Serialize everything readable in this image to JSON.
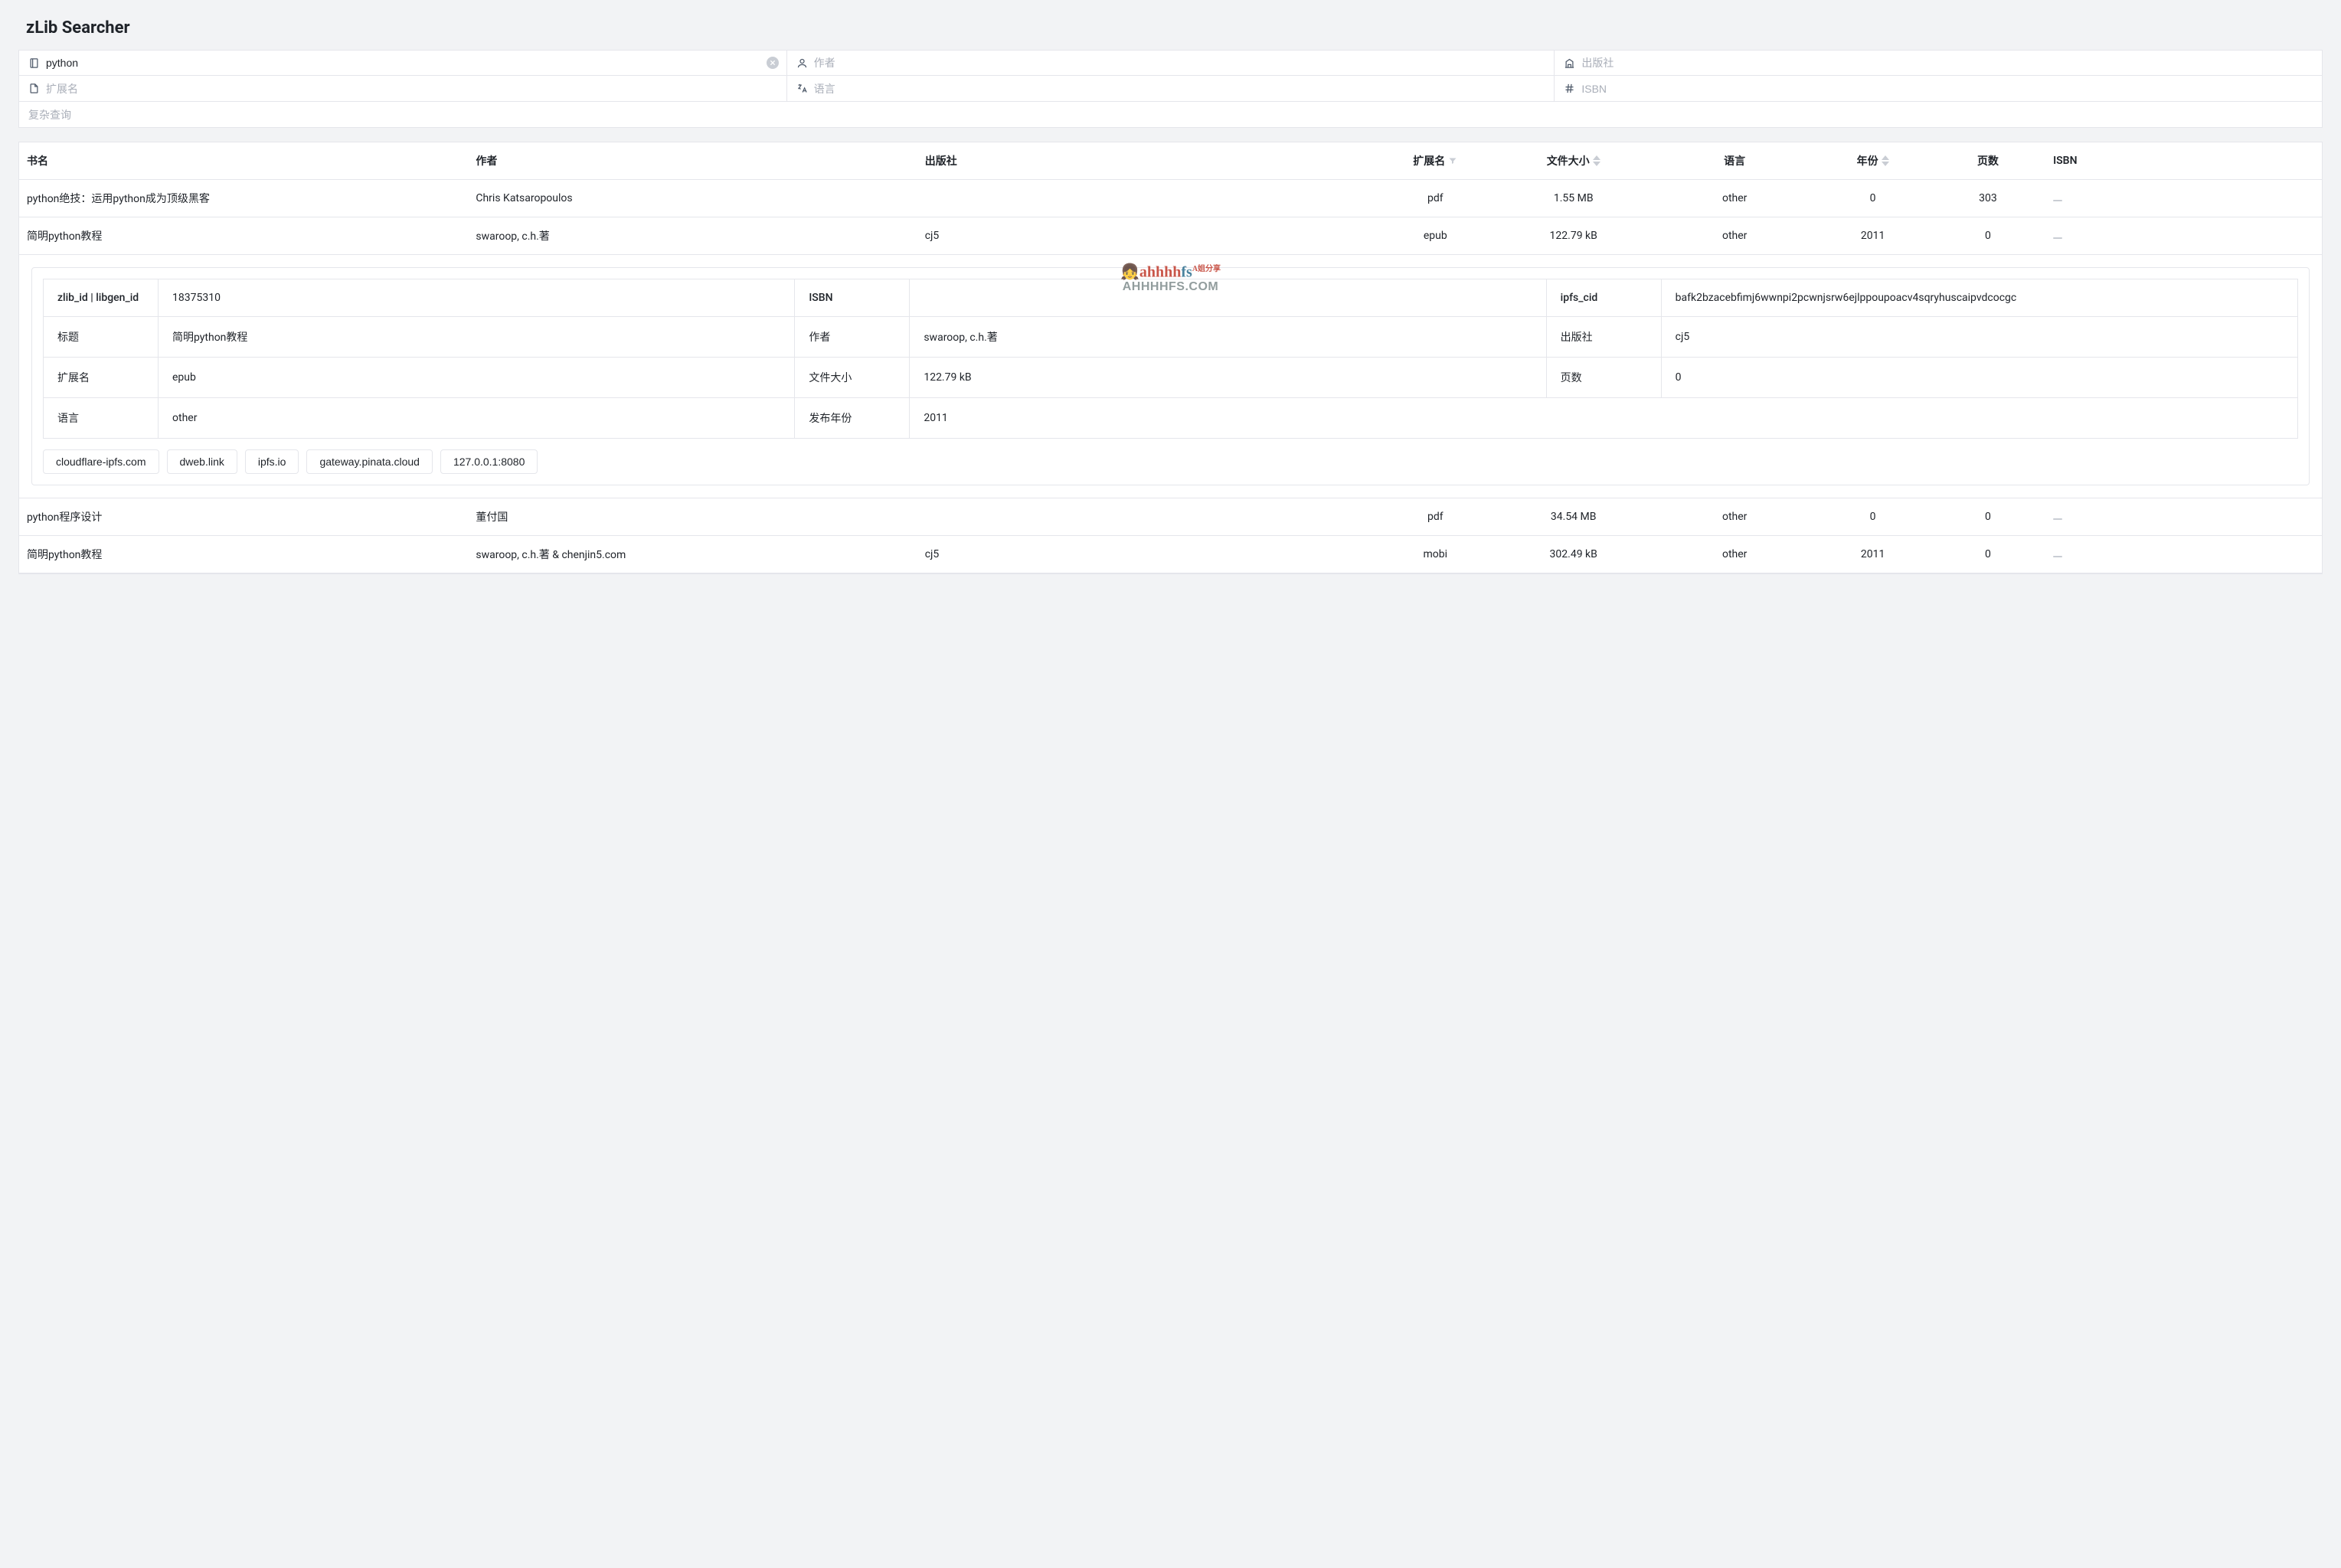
{
  "app": {
    "title": "zLib Searcher"
  },
  "filters": {
    "title": {
      "value": "python",
      "placeholder": ""
    },
    "author": {
      "placeholder": "作者"
    },
    "publisher": {
      "placeholder": "出版社"
    },
    "extension": {
      "placeholder": "扩展名"
    },
    "language": {
      "placeholder": "语言"
    },
    "isbn": {
      "placeholder": "ISBN"
    },
    "complex": {
      "placeholder": "复杂查询"
    }
  },
  "columns": {
    "title": "书名",
    "author": "作者",
    "publisher": "出版社",
    "extension": "扩展名",
    "filesize": "文件大小",
    "language": "语言",
    "year": "年份",
    "pages": "页数",
    "isbn": "ISBN"
  },
  "rows": [
    {
      "title": "python绝技：运用python成为顶级黑客",
      "author": "Chris Katsaropoulos",
      "publisher": "",
      "ext": "pdf",
      "size": "1.55 MB",
      "lang": "other",
      "year": "0",
      "pages": "303",
      "isbn": ""
    },
    {
      "title": "简明python教程",
      "author": "swaroop, c.h.著",
      "publisher": "cj5",
      "ext": "epub",
      "size": "122.79 kB",
      "lang": "other",
      "year": "2011",
      "pages": "0",
      "isbn": ""
    },
    {
      "title": "python程序设计",
      "author": "董付国",
      "publisher": "",
      "ext": "pdf",
      "size": "34.54 MB",
      "lang": "other",
      "year": "0",
      "pages": "0",
      "isbn": ""
    },
    {
      "title": "简明python教程",
      "author": "swaroop, c.h.著 & chenjin5.com",
      "publisher": "cj5",
      "ext": "mobi",
      "size": "302.49 kB",
      "lang": "other",
      "year": "2011",
      "pages": "0",
      "isbn": ""
    }
  ],
  "detail": {
    "labels": {
      "ids": "zlib_id | libgen_id",
      "isbn": "ISBN",
      "ipfs_cid": "ipfs_cid",
      "title": "标题",
      "author": "作者",
      "publisher": "出版社",
      "extension": "扩展名",
      "filesize": "文件大小",
      "pages": "页数",
      "language": "语言",
      "year": "发布年份"
    },
    "values": {
      "ids": "18375310",
      "isbn": "",
      "ipfs_cid": "bafk2bzacebfimj6wwnpi2pcwnjsrw6ejlppoupoacv4sqryhuscaipvdcocgc",
      "title": "简明python教程",
      "author": "swaroop, c.h.著",
      "publisher": "cj5",
      "extension": "epub",
      "filesize": "122.79 kB",
      "pages": "0",
      "language": "other",
      "year": "2011"
    },
    "gateways": [
      "cloudflare-ipfs.com",
      "dweb.link",
      "ipfs.io",
      "gateway.pinata.cloud",
      "127.0.0.1:8080"
    ]
  },
  "watermark": {
    "line1_a": "ahhhh",
    "line1_b": "fs",
    "tag": "A姐分享",
    "line2": "AHHHHFS.COM"
  }
}
